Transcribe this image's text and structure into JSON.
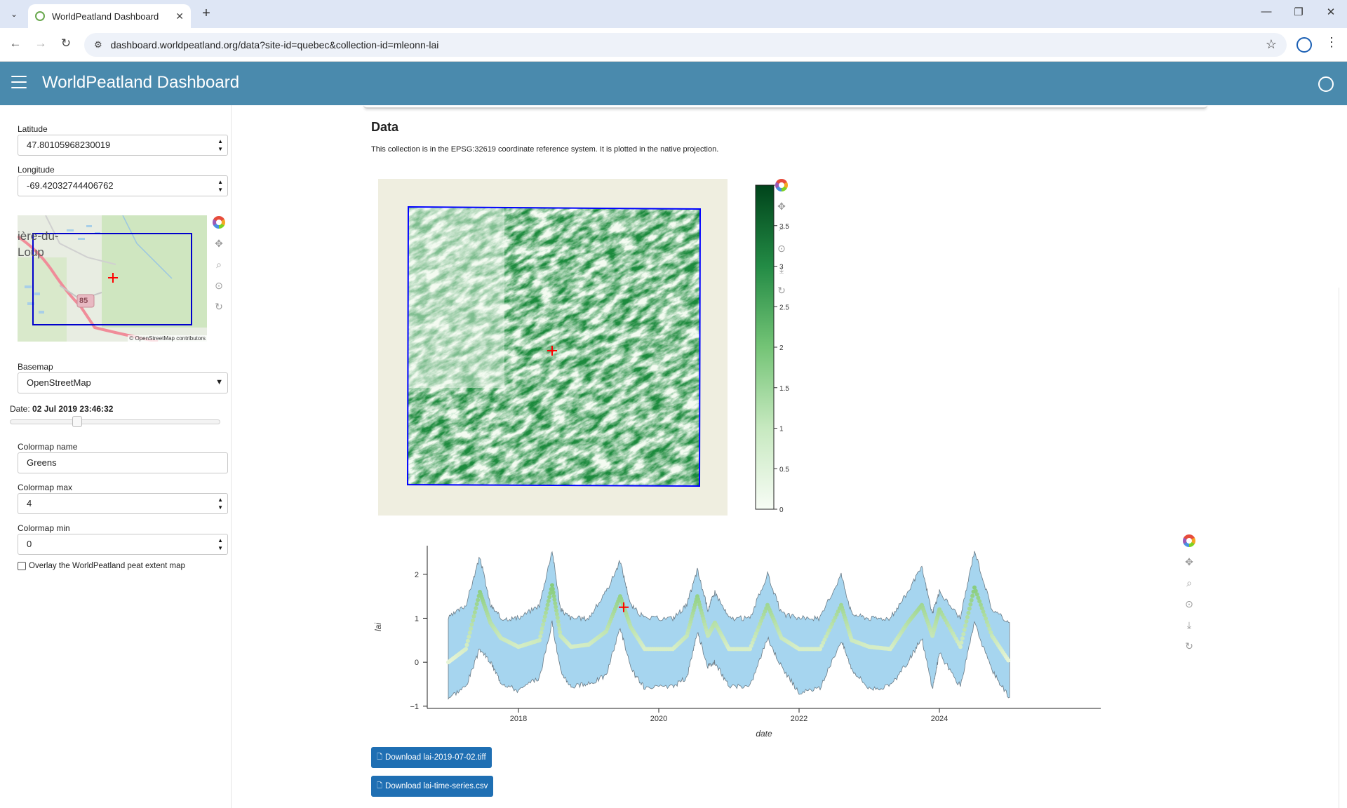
{
  "browser": {
    "tab_title": "WorldPeatland Dashboard",
    "url": "dashboard.worldpeatland.org/data?site-id=quebec&collection-id=mleonn-lai"
  },
  "app": {
    "title": "WorldPeatland Dashboard"
  },
  "sidebar": {
    "latitude_label": "Latitude",
    "latitude_value": "47.80105968230019",
    "longitude_label": "Longitude",
    "longitude_value": "-69.42032744406762",
    "mini_map": {
      "place_label_line1": "ière-du-",
      "place_label_line2": "Loup",
      "road_shield": "85",
      "attribution": "© OpenStreetMap contributors"
    },
    "basemap_label": "Basemap",
    "basemap_value": "OpenStreetMap",
    "date_label": "Date:",
    "date_value": "02 Jul 2019 23:46:32",
    "date_slider_position": 0.32,
    "colormap_name_label": "Colormap name",
    "colormap_name_value": "Greens",
    "colormap_max_label": "Colormap max",
    "colormap_max_value": "4",
    "colormap_min_label": "Colormap min",
    "colormap_min_value": "0",
    "overlay_label": "Overlay the WorldPeatland peat extent map",
    "overlay_checked": false
  },
  "main": {
    "heading": "Data",
    "crs_note": "This collection is in the EPSG:32619 coordinate reference system. It is plotted in the native projection.",
    "download_tiff_label": "Download lai-2019-07-02.tiff",
    "download_csv_label": "Download lai-time-series.csv"
  },
  "colors": {
    "header": "#4a8aad",
    "button": "#1f6fb3",
    "band": "#a6d5ef",
    "bbox": "#0000ff",
    "marker": "#ff0000"
  },
  "chart_data": [
    {
      "type": "heatmap",
      "colormap": "Greens",
      "colorbar_ticks": [
        "0",
        "0.5",
        "1",
        "1.5",
        "2",
        "2.5",
        "3",
        "3.5",
        "4"
      ],
      "clim": [
        0,
        4
      ]
    },
    {
      "type": "area",
      "xlabel": "date",
      "ylabel": "lai",
      "x_ticks": [
        "2018",
        "2020",
        "2022",
        "2024"
      ],
      "y_ticks": [
        "−1",
        "0",
        "1",
        "2"
      ],
      "ylim": [
        -1.05,
        2.65
      ],
      "xlim": [
        2016.7,
        2026.3
      ],
      "series": [
        {
          "x": [
            2017.0,
            2017.25,
            2017.45,
            2017.6,
            2017.75,
            2018.0,
            2018.3,
            2018.48,
            2018.6,
            2018.75,
            2019.0,
            2019.25,
            2019.45,
            2019.6,
            2019.8,
            2020.2,
            2020.4,
            2020.55,
            2020.7,
            2020.8,
            2021.0,
            2021.3,
            2021.55,
            2021.75,
            2022.0,
            2022.3,
            2022.6,
            2022.75,
            2023.0,
            2023.3,
            2023.55,
            2023.75,
            2023.9,
            2024.0,
            2024.3,
            2024.5,
            2024.75,
            2025.0
          ],
          "mean": [
            0.0,
            0.3,
            1.6,
            0.9,
            0.55,
            0.35,
            0.5,
            1.75,
            0.6,
            0.35,
            0.4,
            0.7,
            1.5,
            0.8,
            0.3,
            0.3,
            0.6,
            1.5,
            0.6,
            0.9,
            0.3,
            0.3,
            1.3,
            0.55,
            0.3,
            0.3,
            1.3,
            0.5,
            0.35,
            0.3,
            0.9,
            1.3,
            0.6,
            1.2,
            0.35,
            1.7,
            0.6,
            0.0
          ],
          "upper": [
            1.0,
            1.3,
            2.4,
            1.3,
            1.0,
            1.0,
            1.3,
            2.55,
            1.2,
            1.0,
            1.0,
            1.6,
            2.3,
            1.3,
            1.0,
            1.0,
            1.3,
            2.1,
            1.2,
            1.6,
            1.0,
            1.0,
            2.0,
            1.1,
            1.0,
            1.0,
            2.0,
            1.1,
            1.0,
            1.0,
            1.6,
            2.15,
            1.1,
            1.6,
            1.0,
            2.55,
            1.2,
            0.9
          ],
          "lower": [
            -0.8,
            -0.55,
            0.3,
            0.0,
            -0.45,
            -0.65,
            -0.35,
            0.9,
            -0.2,
            -0.55,
            -0.5,
            -0.3,
            0.8,
            -0.15,
            -0.6,
            -0.55,
            -0.35,
            0.7,
            -0.1,
            0.0,
            -0.55,
            -0.55,
            0.55,
            -0.1,
            -0.7,
            -0.6,
            0.5,
            -0.15,
            -0.6,
            -0.55,
            0.0,
            0.55,
            -0.6,
            0.2,
            -0.55,
            0.9,
            -0.2,
            -0.8
          ]
        }
      ],
      "marker": {
        "x": 2019.5,
        "y": 1.25
      }
    }
  ]
}
